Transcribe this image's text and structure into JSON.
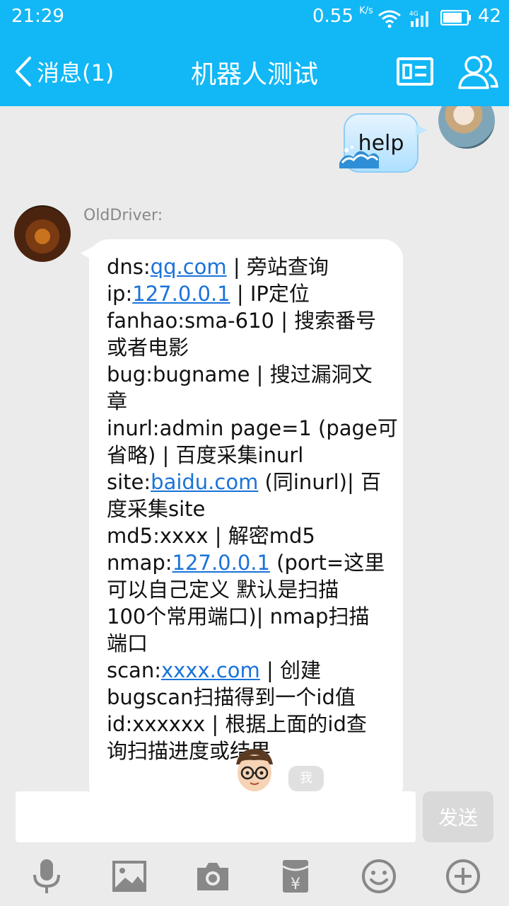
{
  "status_bar": {
    "time": "21:29",
    "network_speed": "0.55",
    "speed_unit": "K/s",
    "network_type": "4G",
    "battery_level": "42"
  },
  "header": {
    "back_label": "消息(1)",
    "title": "机器人测试",
    "icons": [
      "back-chevron-icon",
      "profile-card-icon",
      "group-members-icon"
    ],
    "bg_color": "#12b7f5"
  },
  "messages": {
    "sent": {
      "text": "help"
    },
    "received": {
      "sender": "OldDriver:",
      "lines": [
        {
          "pre": "dns:",
          "link": "qq.com",
          "post": " | 旁站查询"
        },
        {
          "pre": "ip:",
          "link": "127.0.0.1",
          "post": " | IP定位"
        },
        {
          "pre": "fanhao:sma-610 | 搜索番号",
          "link": "",
          "post": ""
        },
        {
          "pre": "或者电影",
          "link": "",
          "post": ""
        },
        {
          "pre": "bug:bugname | 搜过漏洞文",
          "link": "",
          "post": ""
        },
        {
          "pre": "章",
          "link": "",
          "post": ""
        },
        {
          "pre": "inurl:admin page=1 (page可",
          "link": "",
          "post": ""
        },
        {
          "pre": "省略) | 百度采集inurl",
          "link": "",
          "post": ""
        },
        {
          "pre": "site:",
          "link": "baidu.com",
          "post": " (同inurl)| 百"
        },
        {
          "pre": "度采集site",
          "link": "",
          "post": ""
        },
        {
          "pre": "md5:xxxx | 解密md5",
          "link": "",
          "post": ""
        },
        {
          "pre": "nmap:",
          "link": "127.0.0.1",
          "post": " (port=这里"
        },
        {
          "pre": "可以自己定义 默认是扫描",
          "link": "",
          "post": ""
        },
        {
          "pre": "100个常用端口)| nmap扫描",
          "link": "",
          "post": ""
        },
        {
          "pre": "端口",
          "link": "",
          "post": ""
        },
        {
          "pre": "scan:",
          "link": "xxxx.com",
          "post": " | 创建"
        },
        {
          "pre": "bugscan扫描得到一个id值",
          "link": "",
          "post": ""
        },
        {
          "pre": "id:xxxxxx | 根据上面的id查",
          "link": "",
          "post": ""
        },
        {
          "pre": "询扫描进度或",
          "link": "",
          "post": "结果"
        }
      ]
    },
    "me_badge": "我"
  },
  "input": {
    "value": "",
    "placeholder": "",
    "send_label": "发送"
  },
  "toolbar": {
    "icons": [
      "microphone-icon",
      "image-icon",
      "camera-icon",
      "red-packet-icon",
      "emoji-icon",
      "plus-icon"
    ]
  }
}
